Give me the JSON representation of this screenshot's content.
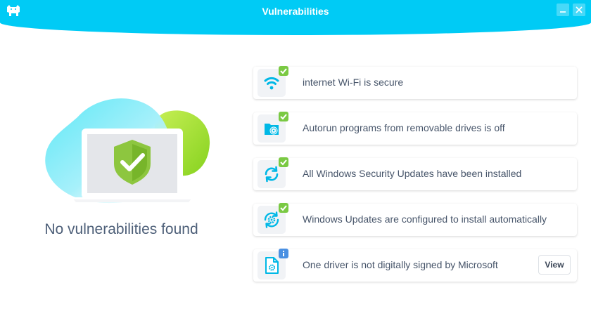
{
  "window": {
    "title": "Vulnerabilities",
    "minimize_icon": "minimize-icon",
    "close_icon": "close-icon",
    "logo_icon": "bulldog-logo-icon"
  },
  "summary": {
    "text": "No vulnerabilities found",
    "illustration_icon": "laptop-shield-check-icon"
  },
  "checks": [
    {
      "text": "internet Wi-Fi is secure",
      "icon": "wifi-icon",
      "status": "ok"
    },
    {
      "text": "Autorun programs from removable drives is off",
      "icon": "removable-drive-icon",
      "status": "ok"
    },
    {
      "text": "All Windows Security Updates have been installed",
      "icon": "refresh-icon",
      "status": "ok"
    },
    {
      "text": "Windows Updates are configured to install automatically",
      "icon": "auto-update-gear-icon",
      "status": "ok"
    },
    {
      "text": "One driver is not digitally signed by Microsoft",
      "icon": "driver-file-icon",
      "status": "info",
      "action_label": "View"
    }
  ],
  "colors": {
    "accent": "#00cbf5",
    "ok": "#7ac943",
    "info": "#4a90e2",
    "text": "#47556a"
  }
}
